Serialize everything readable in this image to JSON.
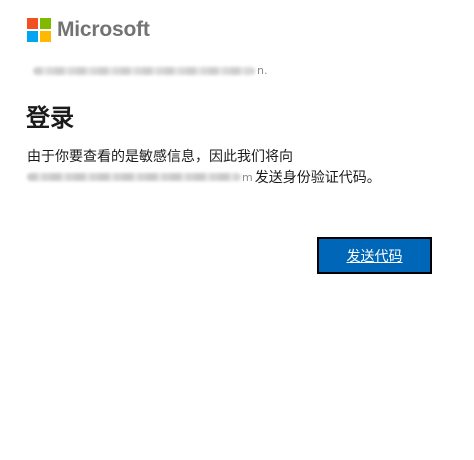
{
  "brand": {
    "name": "Microsoft",
    "colors": [
      "#f25022",
      "#7fba00",
      "#00a4ef",
      "#ffb900"
    ]
  },
  "identity": {
    "prefix": "",
    "suffix": "n."
  },
  "title": "登录",
  "description": {
    "line1": "由于你要查看的是敏感信息，因此我们将向",
    "email_suffix": "m",
    "line2_tail": "发送身份验证代码。"
  },
  "actions": {
    "send_code_label": "发送代码"
  },
  "colors": {
    "accent": "#0067b8"
  }
}
